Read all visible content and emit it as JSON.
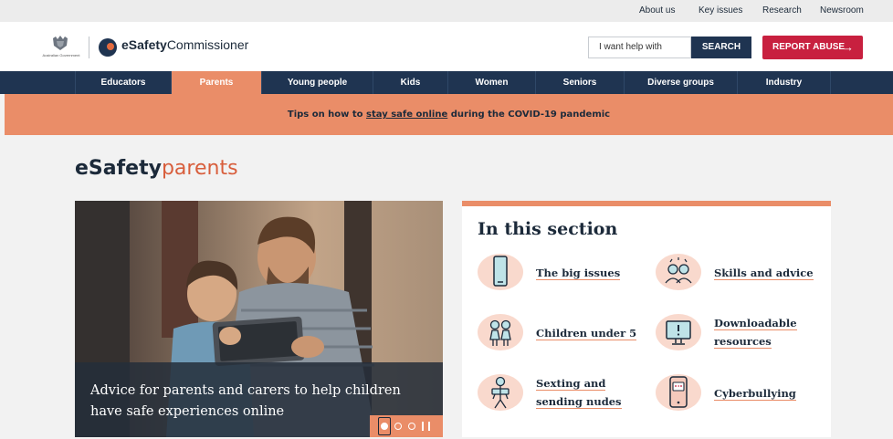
{
  "utility_nav": [
    "About us",
    "Key issues",
    "Research",
    "Newsroom"
  ],
  "header": {
    "gov_text": "Australian Government",
    "logo_bold": "eSafety",
    "logo_light": "Commissioner",
    "search_placeholder": "I want help with",
    "search_button": "SEARCH",
    "report_button": "REPORT ABUSE",
    "report_arrow": "→"
  },
  "main_nav": {
    "active": "Parents",
    "items": [
      "Educators",
      "Parents",
      "Young people",
      "Kids",
      "Women",
      "Seniors",
      "Diverse groups",
      "Industry"
    ]
  },
  "banner": {
    "pre": "Tips on how to ",
    "link": "stay safe online",
    "post": " during the COVID-19 pandemic"
  },
  "page_title": {
    "part1": "eSafety",
    "part2": "parents"
  },
  "hero": {
    "caption": "Advice for parents and carers to help children have safe experiences online",
    "slide_count": 3,
    "active_slide": 1
  },
  "section": {
    "heading": "In this section",
    "items": [
      {
        "label_lines": [
          "The big issues"
        ],
        "icon": "phone-icon"
      },
      {
        "label_lines": [
          "Skills and advice"
        ],
        "icon": "people-icon"
      },
      {
        "label_lines": [
          "Children under 5"
        ],
        "icon": "children-icon"
      },
      {
        "label_lines": [
          "Downloadable",
          "resources"
        ],
        "icon": "monitor-icon"
      },
      {
        "label_lines": [
          "Sexting and",
          "sending nudes"
        ],
        "icon": "person-icon"
      },
      {
        "label_lines": [
          "Cyberbullying"
        ],
        "icon": "message-phone-icon"
      }
    ]
  },
  "colors": {
    "navy": "#1f3451",
    "orange": "#ea8d68",
    "report_red": "#c8203f",
    "title_accent": "#d85e3c",
    "icon_blob": "#f9d9cd"
  }
}
